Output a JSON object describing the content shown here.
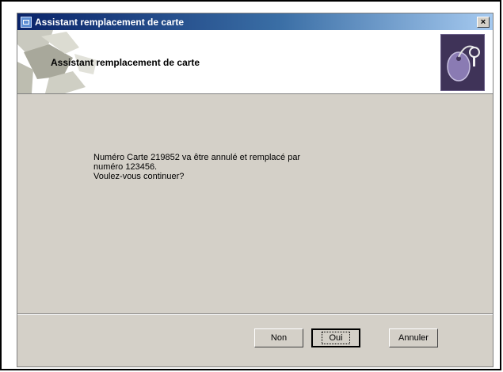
{
  "window": {
    "title": "Assistant remplacement de carte",
    "close_label": "×"
  },
  "header": {
    "title": "Assistant remplacement de carte"
  },
  "message": {
    "line1": "Numéro Carte 219852  va être annulé et remplacé par",
    "line2": "numéro 123456.",
    "line3": "Voulez-vous continuer?"
  },
  "buttons": {
    "no": "Non",
    "yes": "Oui",
    "cancel": "Annuler"
  },
  "colors": {
    "titlebar_start": "#0a246a",
    "titlebar_end": "#a6caf0",
    "dialog_bg": "#d4d0c8"
  },
  "icons": {
    "app": "wizard-app-icon",
    "header_logo": "card-key-icon",
    "close": "close-icon"
  }
}
